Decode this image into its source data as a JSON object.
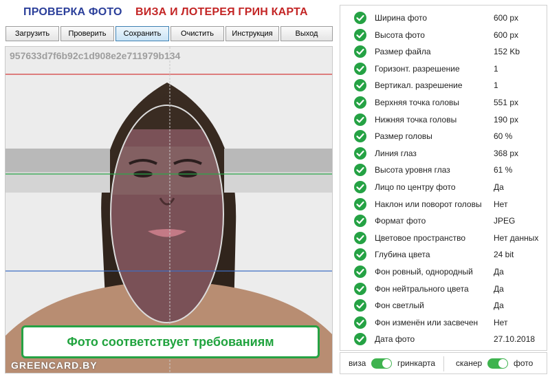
{
  "header": {
    "title_left": "ПРОВЕРКА ФОТО",
    "title_right": "ВИЗА И ЛОТЕРЕЯ ГРИН КАРТА"
  },
  "toolbar": {
    "buttons": [
      {
        "label": "Загрузить"
      },
      {
        "label": "Проверить"
      },
      {
        "label": "Сохранить"
      },
      {
        "label": "Очистить"
      },
      {
        "label": "Инструкция"
      },
      {
        "label": "Выход"
      }
    ]
  },
  "photo": {
    "hash": "957633d7f6b92c1d908e2e711979b134",
    "status": "Фото соответствует требованиям",
    "watermark": "GREENCARD.BY"
  },
  "checks": [
    {
      "label": "Ширина фото",
      "value": "600 px"
    },
    {
      "label": "Высота фото",
      "value": "600 px"
    },
    {
      "label": "Размер файла",
      "value": "152 Kb"
    },
    {
      "label": "Горизонт. разрешение",
      "value": "1"
    },
    {
      "label": "Вертикал. разрешение",
      "value": "1"
    },
    {
      "label": "Верхняя точка головы",
      "value": "551 px"
    },
    {
      "label": "Нижняя точка головы",
      "value": "190 px"
    },
    {
      "label": "Размер головы",
      "value": "60 %"
    },
    {
      "label": "Линия глаз",
      "value": "368 px"
    },
    {
      "label": "Высота уровня глаз",
      "value": "61 %"
    },
    {
      "label": "Лицо по центру фото",
      "value": "Да"
    },
    {
      "label": "Наклон или поворот головы",
      "value": "Нет"
    },
    {
      "label": "Формат фото",
      "value": "JPEG"
    },
    {
      "label": "Цветовое пространство",
      "value": "Нет данных"
    },
    {
      "label": "Глубина цвета",
      "value": "24 bit"
    },
    {
      "label": "Фон ровный, однородный",
      "value": "Да"
    },
    {
      "label": "Фон нейтрального цвета",
      "value": "Да"
    },
    {
      "label": "Фон светлый",
      "value": "Да"
    },
    {
      "label": "Фон изменён или засвечен",
      "value": "Нет"
    },
    {
      "label": "Дата фото",
      "value": "27.10.2018"
    }
  ],
  "bottom": {
    "left_off": "виза",
    "left_on": "гринкарта",
    "right_off": "сканер",
    "right_on": "фото"
  },
  "colors": {
    "title_left": "#2b3f9a",
    "title_right": "#c32525",
    "ok": "#25a244",
    "toggle": "#3fb34f"
  }
}
